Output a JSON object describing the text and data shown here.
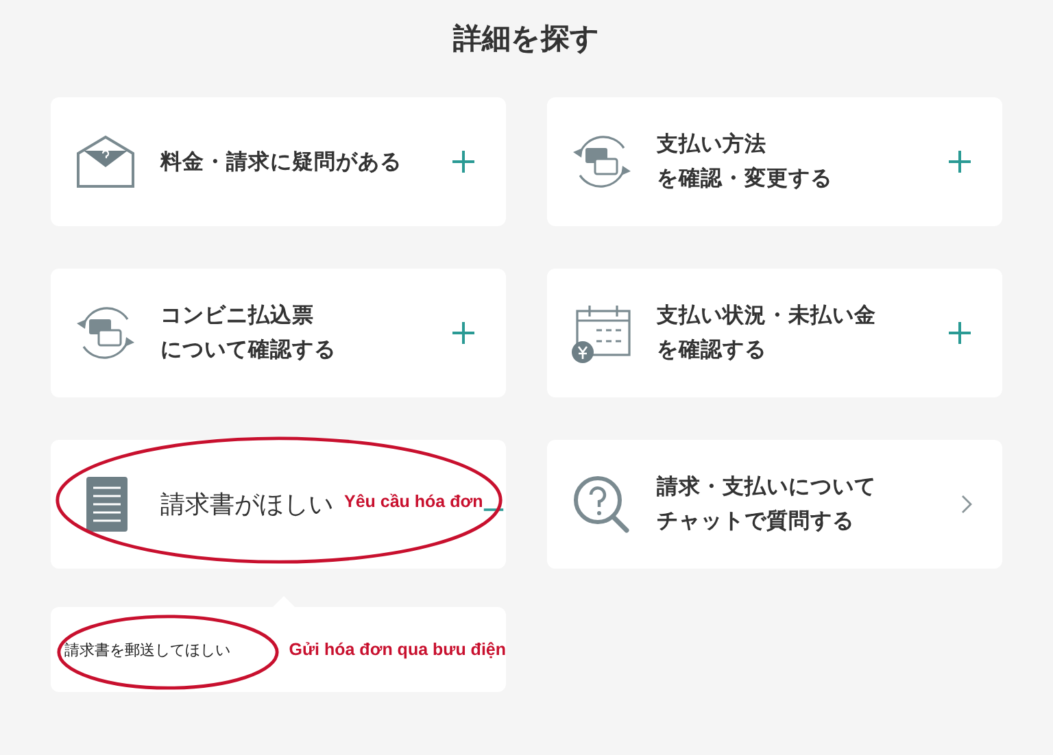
{
  "title": "詳細を探す",
  "cards": [
    {
      "kind": "envelope",
      "lines": [
        "料金・請求に疑問がある"
      ],
      "expanded": false
    },
    {
      "kind": "cards",
      "lines": [
        "支払い方法",
        "を確認・変更する"
      ],
      "expanded": false
    },
    {
      "kind": "cards",
      "lines": [
        "コンビニ払込票",
        "について確認する"
      ],
      "expanded": false
    },
    {
      "kind": "calendar",
      "lines": [
        "支払い状況・未払い金",
        "を確認する"
      ],
      "expanded": false
    },
    {
      "kind": "document",
      "lines": [
        "請求書がほしい"
      ],
      "expanded": true,
      "annotation": "Yêu cầu hóa đơn",
      "children": [
        {
          "label": "請求書を郵送してほしい",
          "annotation": "Gửi hóa đơn qua bưu điện"
        }
      ]
    },
    {
      "kind": "chat",
      "lines": [
        "請求・支払いについて",
        "チャットで質問する"
      ]
    }
  ]
}
